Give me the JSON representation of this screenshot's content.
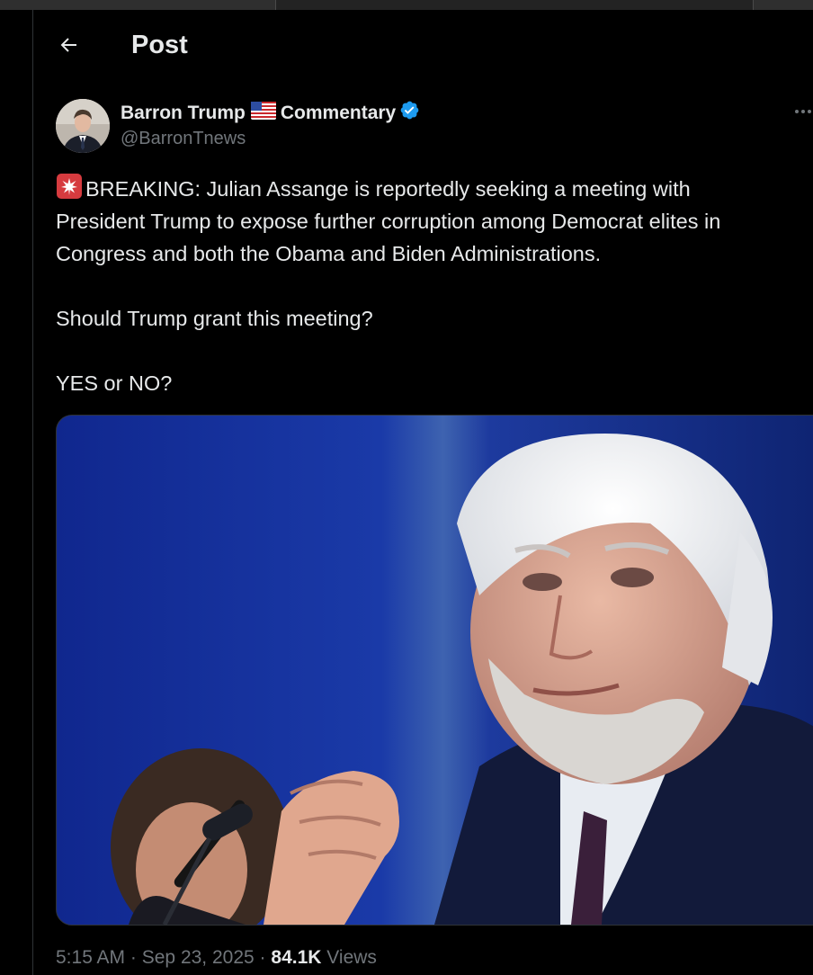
{
  "header": {
    "title": "Post",
    "back_icon": "arrow-left-icon"
  },
  "author": {
    "name_part1": "Barron Trump",
    "flag_icon": "us-flag-icon",
    "name_part2": "Commentary",
    "verified_icon": "verified-badge-icon",
    "handle": "@BarronTnews",
    "avatar_icon": "avatar-image"
  },
  "more_icon": "more-options-icon",
  "tweet": {
    "siren_icon": "rotating-light-icon",
    "lines": [
      "BREAKING: Julian Assange is reportedly seeking a meeting with",
      "President Trump to expose further corruption among Democrat elites in",
      "Congress and both the Obama and Biden Administrations.",
      "Should Trump grant this meeting?",
      "YES or NO?"
    ]
  },
  "media": {
    "image_icon": "photo-image"
  },
  "meta": {
    "time": "5:15 AM",
    "separator": "·",
    "date": "Sep 23, 2025",
    "views_count": "84.1K",
    "views_label": "Views"
  },
  "colors": {
    "background": "#000000",
    "text_primary": "#e7e9ea",
    "text_secondary": "#71767b",
    "verified_blue": "#1d9bf0",
    "border": "#2f3336"
  }
}
